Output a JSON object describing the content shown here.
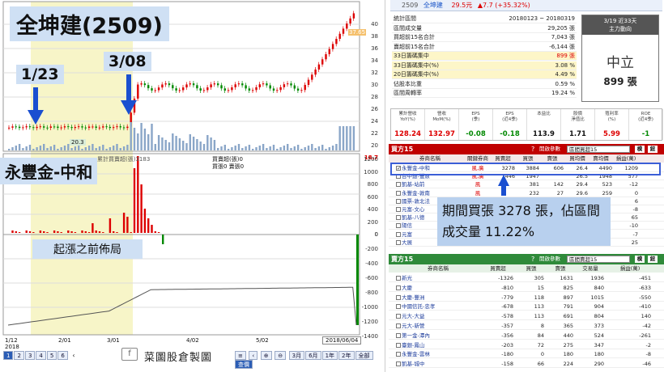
{
  "left": {
    "title": "全坤建(2509)",
    "label_jan": "1/23",
    "label_mar": "3/08",
    "broker_label": "永豐金-中和",
    "pre_rise_label": "起漲之前佈局",
    "price_marker": "37.65",
    "low_marker": "20.3",
    "price_axis": [
      "40",
      "38",
      "36",
      "34",
      "32",
      "30",
      "28",
      "26",
      "24",
      "22",
      "20",
      "18.7"
    ],
    "mid_axis": [
      "1200",
      "1000",
      "800",
      "600",
      "400",
      "200",
      "0"
    ],
    "low_axis": [
      "0",
      "-200",
      "-400",
      "-600",
      "-800",
      "-1000",
      "-1200",
      "-1400"
    ],
    "legend_buy": "買賣超(張)0",
    "legend_sell": "買張0 賣張0",
    "legend_left": "累計買賣超(張)3183",
    "x_labels": [
      "1/12\n2018",
      "2/01",
      "3/01",
      "4/02",
      "5/02"
    ],
    "date_box": "2018/06/04",
    "page_buttons": [
      "1",
      "2",
      "3",
      "4",
      "5",
      "6"
    ],
    "brand": "菜圖股倉製圖",
    "zoom_buttons": [
      "3月",
      "6月",
      "1年",
      "2年",
      "全部",
      "查價"
    ]
  },
  "right": {
    "header_code": "2509",
    "header_name": "全坤建",
    "header_price": "29.5元",
    "header_change": "▲7.7 (+35.32%)",
    "stats_labels": [
      "統計區間",
      "區間成交量",
      "買超前15名合計",
      "賣超前15名合計",
      "33日籌碼集中",
      "33日籌碼集中(%)",
      "20日籌碼集中(%)",
      "佔股本比重",
      "區間周轉率"
    ],
    "stats_values": [
      "20180123 ~ 20180319",
      "29,205 張",
      "7,043 張",
      "-6,144 張",
      "899 張",
      "3.08 %",
      "4.49 %",
      "0.59 %",
      "19.24 %"
    ],
    "trend_box_title": "3/19 近33天",
    "trend_box_sub": "主力動向",
    "trend_state": "中立",
    "trend_value": "899 張",
    "fin_headers": [
      "累計營收\nYoY(%)",
      "營收\nMoM(%)",
      "EPS\n(季)",
      "EPS\n(近4季)",
      "本益比",
      "股價\n淨值比",
      "殖利率\n(%)",
      "ROE\n(近4季)"
    ],
    "fin_values": [
      "128.24",
      "132.97",
      "-0.08",
      "-0.18",
      "113.9",
      "1.71",
      "5.99",
      "-1"
    ],
    "buy_title": "買方15",
    "sell_title": "賣方15",
    "period_label": "開啟參數",
    "period_value": "區間買超15",
    "period_value_sell": "區間賣超15",
    "col_headers": [
      "券商名稱",
      "關鍵券商",
      "買賣超",
      "買張",
      "賣張",
      "買均價",
      "賣均價",
      "損益(萬)"
    ],
    "buy_rows": [
      [
        "永豐金-中和",
        "風,廣",
        "3278",
        "3884",
        "606",
        "26.4",
        "4490",
        "1209"
      ],
      [
        "台中銀-豐原",
        "風,廣",
        "1446",
        "1947",
        "",
        "26.5",
        "1948",
        "577"
      ],
      [
        "凱基-站前",
        "風",
        "",
        "381",
        "142",
        "29.4",
        "523",
        "-12"
      ],
      [
        "永豐金-敦南",
        "風",
        "",
        "232",
        "27",
        "29.6",
        "259",
        "0"
      ],
      [
        "國票-敦北法",
        "",
        "",
        "",
        "",
        "",
        "",
        "6"
      ],
      [
        "元富-文心",
        "",
        "",
        "",
        "",
        "",
        "",
        "-8"
      ],
      [
        "凱基-八德",
        "",
        "",
        "",
        "",
        "",
        "",
        "65"
      ],
      [
        "陽信",
        "",
        "",
        "",
        "",
        "",
        "",
        "-10"
      ],
      [
        "元富",
        "",
        "",
        "",
        "",
        "",
        "",
        "-7"
      ],
      [
        "大展",
        "",
        "",
        "",
        "",
        "",
        "",
        "25"
      ]
    ],
    "sell_col_headers": [
      "券商名稱",
      "買賣超",
      "買張",
      "賣張",
      "交易量",
      "損益(萬)"
    ],
    "sell_rows": [
      [
        "新光",
        "-1326",
        "305",
        "1631",
        "1936",
        "-451"
      ],
      [
        "大慶",
        "-810",
        "15",
        "825",
        "840",
        "-633"
      ],
      [
        "大慶-豐洲",
        "-779",
        "118",
        "897",
        "1015",
        "-550"
      ],
      [
        "中國信託-忠孝",
        "-678",
        "113",
        "791",
        "904",
        "-410"
      ],
      [
        "元大-大益",
        "-578",
        "113",
        "691",
        "804",
        "140"
      ],
      [
        "元大-新營",
        "-357",
        "8",
        "365",
        "373",
        "-42"
      ],
      [
        "第一金-潭內",
        "-356",
        "84",
        "440",
        "524",
        "-261"
      ],
      [
        "臺銀-鳳山",
        "-203",
        "72",
        "275",
        "347",
        "-2"
      ],
      [
        "永豐金-雲林",
        "-180",
        "0",
        "180",
        "180",
        "-8"
      ],
      [
        "凱基-城中",
        "-158",
        "66",
        "224",
        "290",
        "-46"
      ]
    ],
    "callout": "期間買張 3278 張，佔區間成交量 11.22%"
  },
  "colors": {
    "buy_header": "#c00000",
    "sell_header": "#2f8a3a",
    "callout_bg": "#b8d0ee",
    "highlight": "#3b5ed6"
  }
}
